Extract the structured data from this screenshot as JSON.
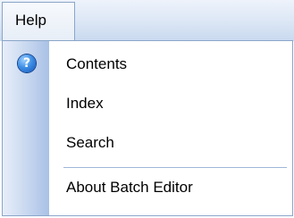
{
  "menubar": {
    "open_menu_label": "Help"
  },
  "help_menu": {
    "items": [
      {
        "label": "Contents",
        "icon": "help-icon"
      },
      {
        "label": "Index"
      },
      {
        "label": "Search"
      },
      {
        "label": "About Batch Editor"
      }
    ],
    "icon_glyph": "?",
    "colors": {
      "border": "#8aa6c9",
      "gutter": "#c3d4ee",
      "help_icon": "#3d8fe6"
    }
  }
}
